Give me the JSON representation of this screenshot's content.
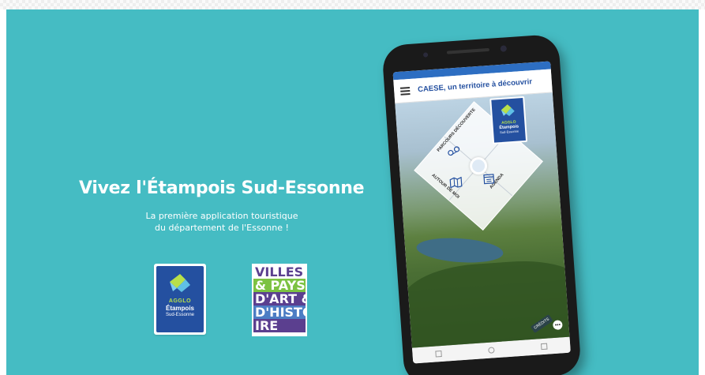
{
  "colors": {
    "teal_background": "#45bcc3",
    "agglo_blue": "#2450a0",
    "agglo_green": "#b8e04a",
    "vah_purple": "#5b3f8f",
    "vah_green": "#7cc242",
    "vah_blue": "#4d7dc4"
  },
  "banner": {
    "headline": "Vivez l'Étampois Sud-Essonne",
    "subline_1": "La première application touristique",
    "subline_2": "du département de l'Essonne !"
  },
  "agglo_logo": {
    "line1": "AGGLO",
    "line2": "Étampois",
    "line3": "Sud-Essonne"
  },
  "vah_logo": {
    "lines": [
      "VILLES",
      "& PAYS",
      "D'ART &",
      "D'HISTO",
      "IRE"
    ]
  },
  "phone": {
    "app_title": "CAESE, un territoire à découvrir",
    "menu_icon": "hamburger-menu-icon",
    "diamond": {
      "top_label": "PARCOURS DÉCOUVERTE",
      "left_label": "AUTOUR DE MOI",
      "right_label": "AGENDA"
    },
    "app_logo": {
      "line1": "AGGLO",
      "line2": "Étampois",
      "line3": "Sud-Essonne"
    },
    "credits": "CRÉDITS",
    "more_symbol": "•••"
  }
}
